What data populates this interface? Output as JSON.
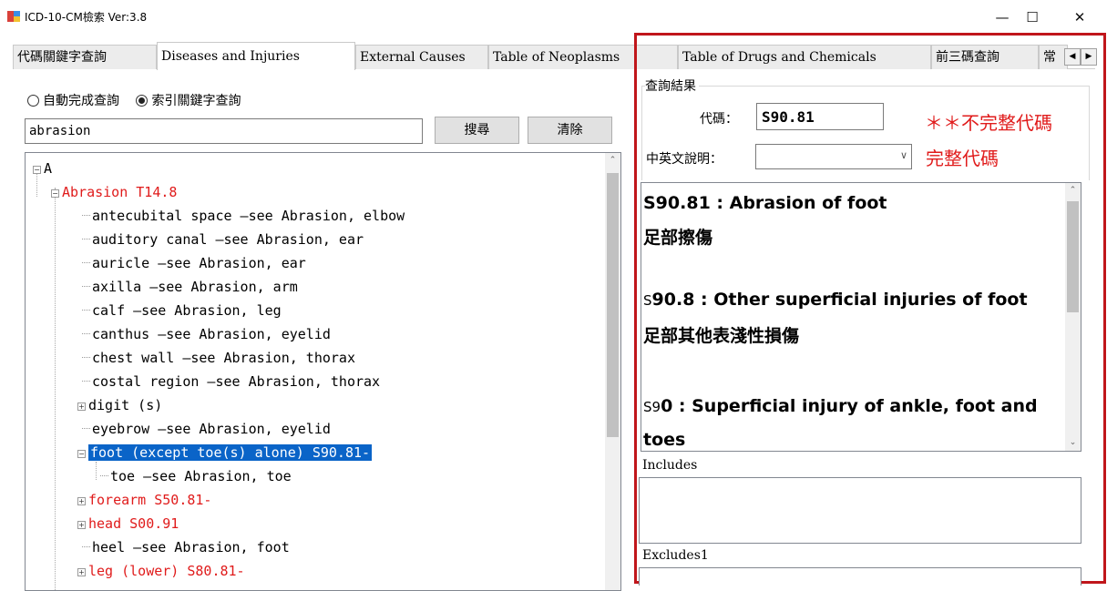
{
  "window": {
    "title": "ICD-10-CM檢索  Ver:3.8",
    "minimize": "—",
    "maximize": "☐",
    "close": "✕"
  },
  "tabs": [
    {
      "label": "代碼關鍵字查詢"
    },
    {
      "label": "Diseases and Injuries"
    },
    {
      "label": "External Causes"
    },
    {
      "label": "Table of Neoplasms"
    },
    {
      "label": "Table of Drugs and Chemicals"
    },
    {
      "label": "前三碼查詢"
    },
    {
      "label": "常"
    }
  ],
  "tab_scroll": {
    "left": "◀",
    "right": "▶"
  },
  "search": {
    "mode_autocomplete": "自動完成查詢",
    "mode_index": "索引關鍵字查詢",
    "selected_mode": "索引關鍵字查詢",
    "query": "abrasion",
    "search_button": "搜尋",
    "clear_button": "清除"
  },
  "tree": {
    "root": "A",
    "rows": [
      {
        "text": "Abrasion  T14.8",
        "red": true
      },
      {
        "text": "antecubital space  —see Abrasion, elbow"
      },
      {
        "text": "auditory canal  —see Abrasion, ear"
      },
      {
        "text": "auricle  —see Abrasion, ear"
      },
      {
        "text": "axilla  —see Abrasion, arm"
      },
      {
        "text": "calf  —see Abrasion, leg"
      },
      {
        "text": "canthus  —see Abrasion, eyelid"
      },
      {
        "text": "chest wall  —see Abrasion, thorax"
      },
      {
        "text": "costal region  —see Abrasion, thorax"
      },
      {
        "text": "digit (s)"
      },
      {
        "text": "eyebrow  —see Abrasion, eyelid"
      },
      {
        "text": "foot (except toe(s) alone) S90.81-",
        "selected": true
      },
      {
        "text": "toe  —see Abrasion, toe"
      },
      {
        "text": "forearm  S50.81-",
        "red": true
      },
      {
        "text": "head  S00.91",
        "red": true
      },
      {
        "text": "heel  —see Abrasion, foot"
      },
      {
        "text": "leg (lower) S80.81-",
        "red": true
      }
    ]
  },
  "result": {
    "group_title": "查詢結果",
    "code_label": "代碼：",
    "code_value": "S90.81",
    "desc_label": "中英文說明：",
    "annotation_incomplete": "＊＊不完整代碼",
    "annotation_complete": "完整代碼",
    "descriptions": [
      {
        "prefix": "",
        "en": "S90.81 : Abrasion of foot",
        "zh": "足部擦傷"
      },
      {
        "prefix": "S",
        "en": "90.8 : Other superficial injuries of foot",
        "zh": "足部其他表淺性損傷"
      },
      {
        "prefix": "S9",
        "en": "0 : Superficial injury of ankle, foot and",
        "en2": "toes"
      }
    ],
    "includes_label": "Includes",
    "excludes1_label": "Excludes1"
  },
  "colors": {
    "annotation": "#e01b1b",
    "highlight_border": "#c0161b",
    "selection": "#0a64c8"
  }
}
